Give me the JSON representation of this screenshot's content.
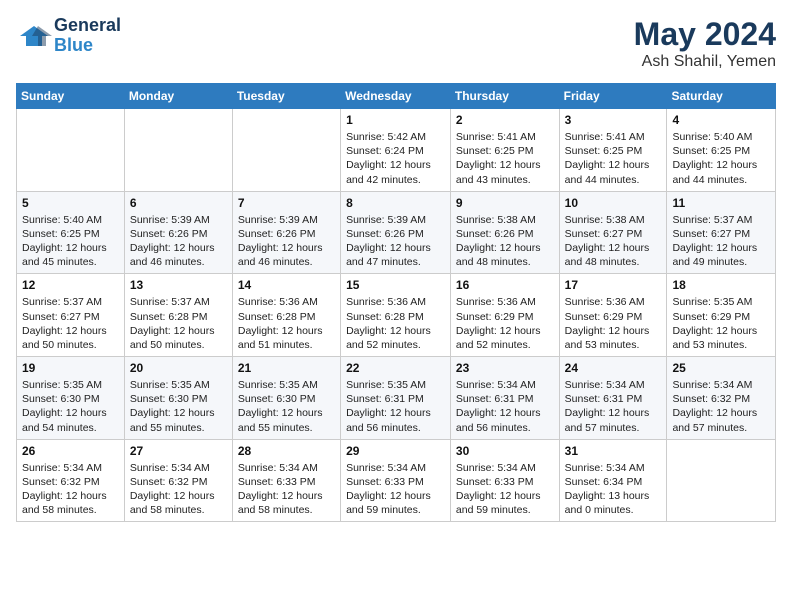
{
  "header": {
    "logo_line1": "General",
    "logo_line2": "Blue",
    "month": "May 2024",
    "location": "Ash Shahil, Yemen"
  },
  "weekdays": [
    "Sunday",
    "Monday",
    "Tuesday",
    "Wednesday",
    "Thursday",
    "Friday",
    "Saturday"
  ],
  "weeks": [
    [
      {
        "day": "",
        "info": ""
      },
      {
        "day": "",
        "info": ""
      },
      {
        "day": "",
        "info": ""
      },
      {
        "day": "1",
        "sunrise": "5:42 AM",
        "sunset": "6:24 PM",
        "daylight": "12 hours and 42 minutes."
      },
      {
        "day": "2",
        "sunrise": "5:41 AM",
        "sunset": "6:25 PM",
        "daylight": "12 hours and 43 minutes."
      },
      {
        "day": "3",
        "sunrise": "5:41 AM",
        "sunset": "6:25 PM",
        "daylight": "12 hours and 44 minutes."
      },
      {
        "day": "4",
        "sunrise": "5:40 AM",
        "sunset": "6:25 PM",
        "daylight": "12 hours and 44 minutes."
      }
    ],
    [
      {
        "day": "5",
        "sunrise": "5:40 AM",
        "sunset": "6:25 PM",
        "daylight": "12 hours and 45 minutes."
      },
      {
        "day": "6",
        "sunrise": "5:39 AM",
        "sunset": "6:26 PM",
        "daylight": "12 hours and 46 minutes."
      },
      {
        "day": "7",
        "sunrise": "5:39 AM",
        "sunset": "6:26 PM",
        "daylight": "12 hours and 46 minutes."
      },
      {
        "day": "8",
        "sunrise": "5:39 AM",
        "sunset": "6:26 PM",
        "daylight": "12 hours and 47 minutes."
      },
      {
        "day": "9",
        "sunrise": "5:38 AM",
        "sunset": "6:26 PM",
        "daylight": "12 hours and 48 minutes."
      },
      {
        "day": "10",
        "sunrise": "5:38 AM",
        "sunset": "6:27 PM",
        "daylight": "12 hours and 48 minutes."
      },
      {
        "day": "11",
        "sunrise": "5:37 AM",
        "sunset": "6:27 PM",
        "daylight": "12 hours and 49 minutes."
      }
    ],
    [
      {
        "day": "12",
        "sunrise": "5:37 AM",
        "sunset": "6:27 PM",
        "daylight": "12 hours and 50 minutes."
      },
      {
        "day": "13",
        "sunrise": "5:37 AM",
        "sunset": "6:28 PM",
        "daylight": "12 hours and 50 minutes."
      },
      {
        "day": "14",
        "sunrise": "5:36 AM",
        "sunset": "6:28 PM",
        "daylight": "12 hours and 51 minutes."
      },
      {
        "day": "15",
        "sunrise": "5:36 AM",
        "sunset": "6:28 PM",
        "daylight": "12 hours and 52 minutes."
      },
      {
        "day": "16",
        "sunrise": "5:36 AM",
        "sunset": "6:29 PM",
        "daylight": "12 hours and 52 minutes."
      },
      {
        "day": "17",
        "sunrise": "5:36 AM",
        "sunset": "6:29 PM",
        "daylight": "12 hours and 53 minutes."
      },
      {
        "day": "18",
        "sunrise": "5:35 AM",
        "sunset": "6:29 PM",
        "daylight": "12 hours and 53 minutes."
      }
    ],
    [
      {
        "day": "19",
        "sunrise": "5:35 AM",
        "sunset": "6:30 PM",
        "daylight": "12 hours and 54 minutes."
      },
      {
        "day": "20",
        "sunrise": "5:35 AM",
        "sunset": "6:30 PM",
        "daylight": "12 hours and 55 minutes."
      },
      {
        "day": "21",
        "sunrise": "5:35 AM",
        "sunset": "6:30 PM",
        "daylight": "12 hours and 55 minutes."
      },
      {
        "day": "22",
        "sunrise": "5:35 AM",
        "sunset": "6:31 PM",
        "daylight": "12 hours and 56 minutes."
      },
      {
        "day": "23",
        "sunrise": "5:34 AM",
        "sunset": "6:31 PM",
        "daylight": "12 hours and 56 minutes."
      },
      {
        "day": "24",
        "sunrise": "5:34 AM",
        "sunset": "6:31 PM",
        "daylight": "12 hours and 57 minutes."
      },
      {
        "day": "25",
        "sunrise": "5:34 AM",
        "sunset": "6:32 PM",
        "daylight": "12 hours and 57 minutes."
      }
    ],
    [
      {
        "day": "26",
        "sunrise": "5:34 AM",
        "sunset": "6:32 PM",
        "daylight": "12 hours and 58 minutes."
      },
      {
        "day": "27",
        "sunrise": "5:34 AM",
        "sunset": "6:32 PM",
        "daylight": "12 hours and 58 minutes."
      },
      {
        "day": "28",
        "sunrise": "5:34 AM",
        "sunset": "6:33 PM",
        "daylight": "12 hours and 58 minutes."
      },
      {
        "day": "29",
        "sunrise": "5:34 AM",
        "sunset": "6:33 PM",
        "daylight": "12 hours and 59 minutes."
      },
      {
        "day": "30",
        "sunrise": "5:34 AM",
        "sunset": "6:33 PM",
        "daylight": "12 hours and 59 minutes."
      },
      {
        "day": "31",
        "sunrise": "5:34 AM",
        "sunset": "6:34 PM",
        "daylight": "13 hours and 0 minutes."
      },
      {
        "day": "",
        "info": ""
      }
    ]
  ]
}
